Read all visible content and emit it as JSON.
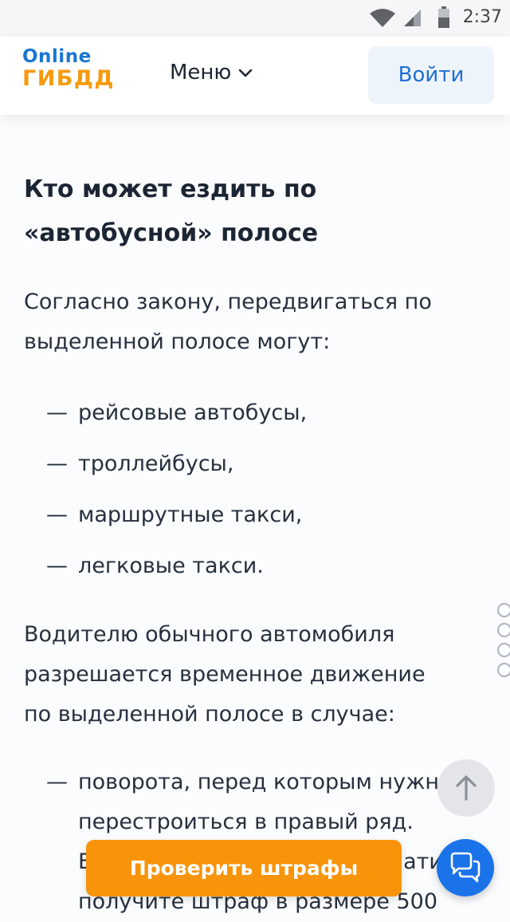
{
  "status_bar": {
    "time": "2:37",
    "icons": [
      "wifi-icon",
      "signal-icon",
      "battery-icon"
    ]
  },
  "header": {
    "logo_top": "Online",
    "logo_bottom": "ГИБДД",
    "menu_label": "Меню",
    "login_label": "Войти"
  },
  "article": {
    "heading_line1": "Кто может ездить по",
    "heading_line2": "«автобусной» полосе",
    "para1_line1": "Согласно закону, передвигаться по",
    "para1_line2": "выделенной полосе могут:",
    "list1": [
      "рейсовые автобусы,",
      "троллейбусы,",
      "маршрутные такси,",
      "легковые такси."
    ],
    "para2_line1": "Водителю обычного автомобиля",
    "para2_line2": "разрешается временное движение",
    "para2_line3": "по выделенной полосе в случае:",
    "list2_item1_line1": "поворота, перед которым нужно",
    "list2_item1_line2": "перестроиться в правый ряд.",
    "list2_item1_line3": "В противном случае вы заплатите",
    "list2_item1_line4": "получите штраф в размере 500"
  },
  "floating": {
    "check_fines_label": "Проверить штрафы"
  },
  "colors": {
    "brand_blue": "#1976d2",
    "brand_orange": "#f59a0c",
    "cta_orange": "#f7940a",
    "chat_blue": "#1a73e8"
  }
}
